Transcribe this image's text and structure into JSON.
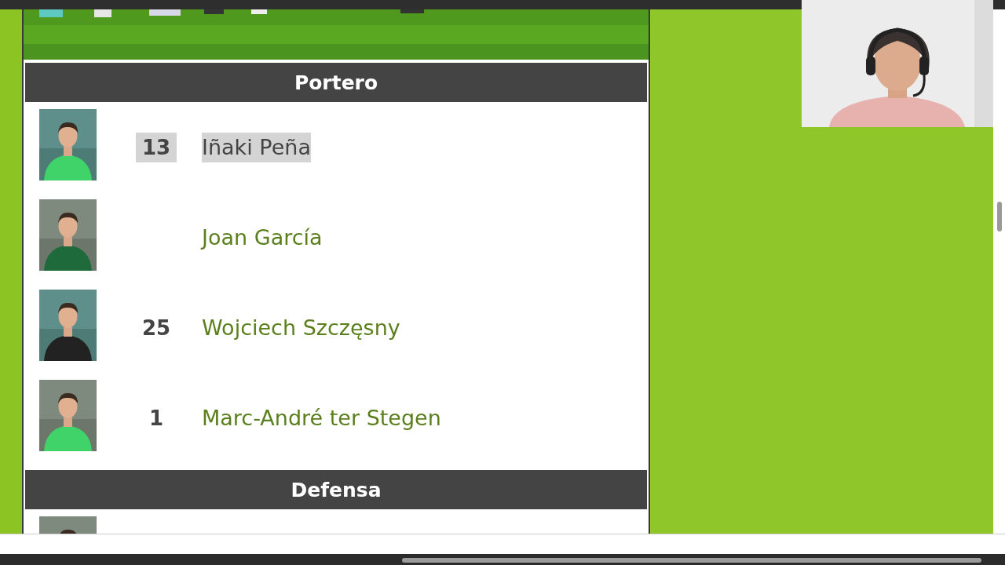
{
  "sections": [
    {
      "title": "Portero",
      "players": [
        {
          "number": "13",
          "name": "Iñaki Peña",
          "selected": true
        },
        {
          "name": "Joan García",
          "selected": false
        },
        {
          "number": "25",
          "name": "Wojciech Szczęsny",
          "selected": false
        },
        {
          "number": "1",
          "name": "Marc-André ter Stegen",
          "selected": false
        }
      ]
    },
    {
      "title": "Defensa"
    }
  ]
}
